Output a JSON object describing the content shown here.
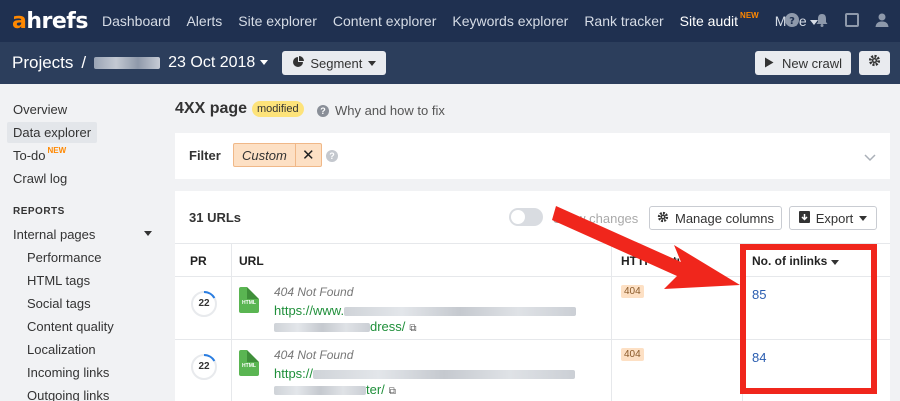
{
  "brand": {
    "logo_a": "a",
    "logo_rest": "hrefs"
  },
  "nav": {
    "items": [
      "Dashboard",
      "Alerts",
      "Site explorer",
      "Content explorer",
      "Keywords explorer",
      "Rank tracker"
    ],
    "site_audit": "Site audit",
    "site_audit_tag": "NEW",
    "more": "More"
  },
  "subbar": {
    "projects": "Projects",
    "slash": "/",
    "date": "23 Oct 2018",
    "segment": "Segment",
    "new_crawl": "New crawl"
  },
  "sidebar": {
    "overview": "Overview",
    "data_explorer": "Data explorer",
    "todo": "To-do",
    "todo_tag": "NEW",
    "crawl_log": "Crawl log",
    "reports_heading": "REPORTS",
    "internal_pages": "Internal pages",
    "subitems": [
      "Performance",
      "HTML tags",
      "Social tags",
      "Content quality",
      "Localization",
      "Incoming links",
      "Outgoing links"
    ]
  },
  "main": {
    "title": "4XX page",
    "badge": "modified",
    "help": "Why and how to fix",
    "filter_label": "Filter",
    "filter_chip": "Custom",
    "url_count": "31 URLs",
    "show_changes": "Show changes",
    "manage_columns": "Manage columns",
    "export": "Export"
  },
  "table": {
    "headers": {
      "pr": "PR",
      "url": "URL",
      "http_status": "HTTP status",
      "inlinks": "No. of inlinks"
    },
    "rows": [
      {
        "pr": "22",
        "file_type": "HTML",
        "status_text": "404 Not Found",
        "url_prefix": "https://www.",
        "url_suffix": "dress/",
        "code": "404",
        "inlinks": "85"
      },
      {
        "pr": "22",
        "file_type": "HTML",
        "status_text": "404 Not Found",
        "url_prefix": "https://",
        "url_suffix": "ter/",
        "code": "404",
        "inlinks": "84"
      }
    ]
  },
  "colors": {
    "nav_bg": "#1f3050",
    "subbar_bg": "#2c3e5c",
    "accent": "#ff8800",
    "annotation_red": "#f0261c",
    "url_green": "#1f8f3a",
    "link_blue": "#2a5db0"
  }
}
